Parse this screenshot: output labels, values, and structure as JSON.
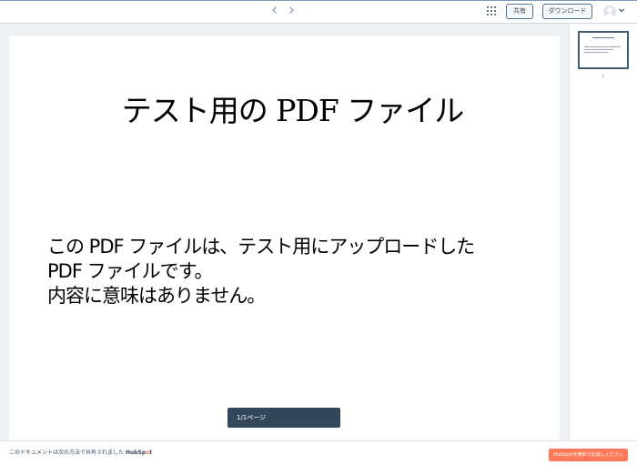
{
  "header": {
    "apps_icon": "grid-icon",
    "share_label": "共有",
    "download_label": "ダウンロード",
    "avatar_icon": "user-avatar",
    "menu_icon": "chevron-down-icon"
  },
  "document": {
    "title": "テスト用の PDF ファイル",
    "body_lines": [
      "この PDF ファイルは、テスト用にアップロードした",
      "PDF ファイルです。",
      "内容に意味はありません。"
    ]
  },
  "sidebar": {
    "thumbnail_page_number": "1"
  },
  "toolbar": {
    "page_indicator": "1/1ページ",
    "prev_icon": "chevron-left-icon",
    "next_icon": "chevron-right-icon",
    "zoom_out_icon": "zoom-out-icon",
    "zoom_in_icon": "zoom-in-icon"
  },
  "footer": {
    "shared_text": "このドキュメントは次の方法で共有されました",
    "logo_text_1": "HubSp",
    "logo_text_2": "o",
    "logo_text_3": "t",
    "cta_label": "HubSpotを無料でお試しください"
  },
  "colors": {
    "accent": "#ff7a59",
    "toolbar_bg": "#33475b",
    "text_dark": "#33475b"
  }
}
